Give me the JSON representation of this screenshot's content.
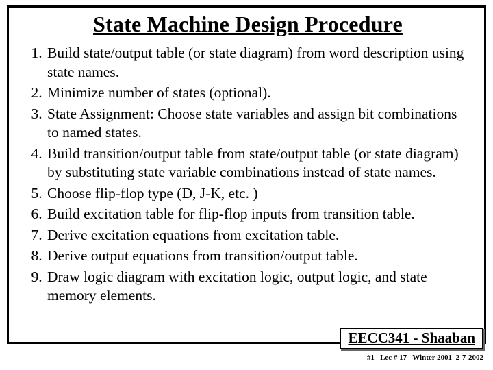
{
  "title": "State Machine Design Procedure",
  "steps": [
    "Build state/output table (or state diagram) from word description using state names.",
    "Minimize number of states (optional).",
    "State Assignment: Choose state variables and assign bit combinations to named states.",
    "Build transition/output table from state/output table (or state diagram) by substituting state variable combinations instead of state names.",
    "Choose flip-flop type (D, J-K, etc. )",
    "Build excitation table for flip-flop inputs from transition table.",
    "Derive excitation equations from excitation table.",
    "Derive output equations from transition/output table.",
    "Draw logic diagram with excitation logic, output logic, and state memory elements."
  ],
  "course_box": "EECC341 - Shaaban",
  "footer": "#1   Lec # 17   Winter 2001  2-7-2002"
}
